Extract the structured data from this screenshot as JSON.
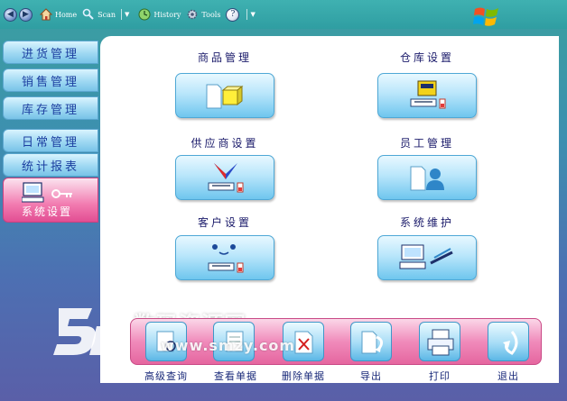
{
  "toolbar": {
    "home_label": "Home",
    "scan_label": "Scan",
    "history_label": "History",
    "tools_label": "Tools"
  },
  "sidebar": {
    "items": [
      {
        "label": "进货管理"
      },
      {
        "label": "销售管理"
      },
      {
        "label": "库存管理"
      },
      {
        "label": "日常管理"
      },
      {
        "label": "统计报表"
      },
      {
        "label": "系统设置",
        "active": true
      }
    ]
  },
  "modules": [
    {
      "title": "商品管理",
      "icon": "product-icon"
    },
    {
      "title": "仓库设置",
      "icon": "warehouse-icon"
    },
    {
      "title": "供应商设置",
      "icon": "supplier-icon"
    },
    {
      "title": "员工管理",
      "icon": "employee-icon"
    },
    {
      "title": "客户设置",
      "icon": "customer-icon"
    },
    {
      "title": "系统维护",
      "icon": "maintenance-icon"
    }
  ],
  "actions": [
    {
      "label": "高级查询",
      "icon": "advanced-search-icon"
    },
    {
      "label": "查看单据",
      "icon": "view-document-icon"
    },
    {
      "label": "删除单据",
      "icon": "delete-document-icon"
    },
    {
      "label": "导出",
      "icon": "export-icon"
    },
    {
      "label": "打印",
      "icon": "print-icon"
    },
    {
      "label": "退出",
      "icon": "exit-icon"
    }
  ],
  "watermark": {
    "text": "数码资源网",
    "url": "www.smzy.com"
  },
  "colors": {
    "background": "#3d8fb0",
    "sidebar_active": "#e24e93",
    "button_blue": "#6fc6ee",
    "action_bar": "#e5669f",
    "title_text": "#1a1a6a"
  }
}
